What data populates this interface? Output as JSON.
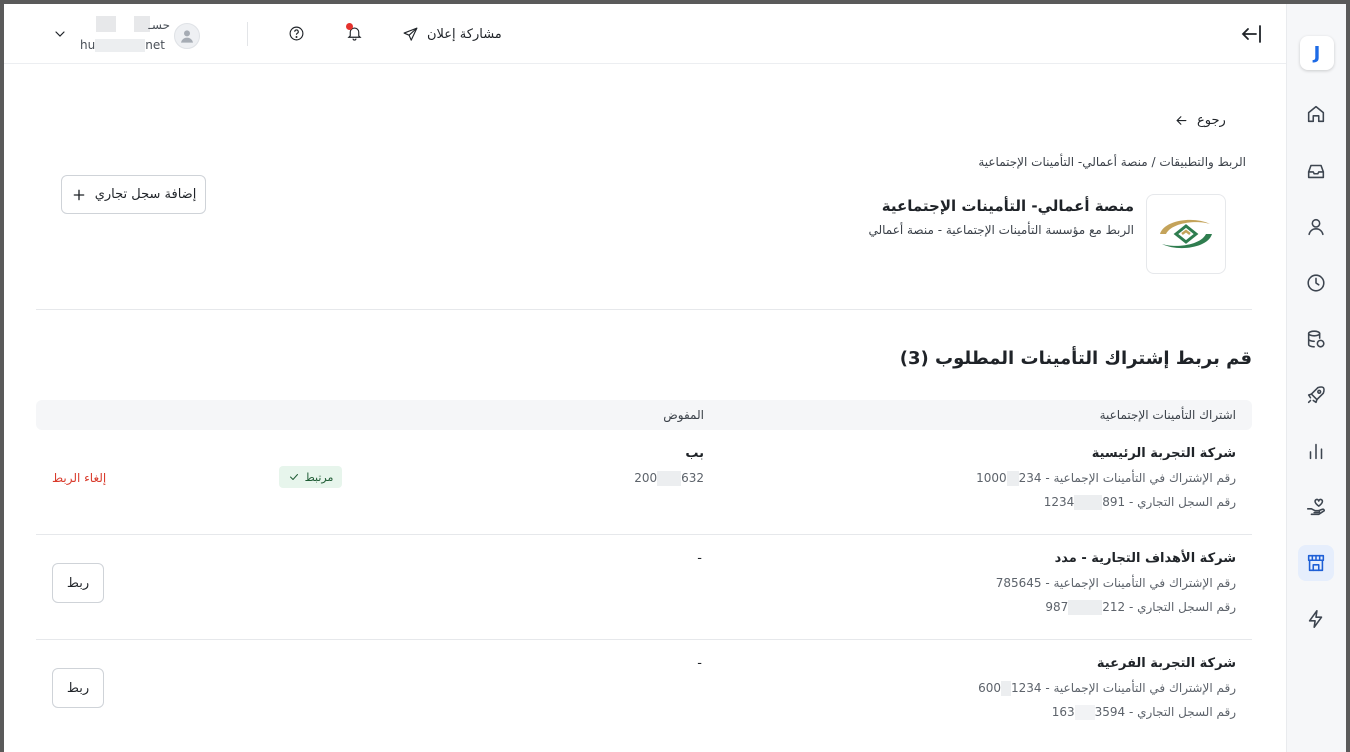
{
  "header": {
    "share_label": "مشاركة إعلان",
    "user_name": "حسـ",
    "user_email_start": "hu",
    "user_email_end": "net"
  },
  "sidebar": {
    "logo_letter": "J",
    "items": [
      "home-icon",
      "inbox-icon",
      "user-icon",
      "clock-icon",
      "database-icon",
      "rocket-icon",
      "chart-icon",
      "hand-heart-icon",
      "store-icon",
      "bolt-icon"
    ],
    "active": "store-icon"
  },
  "page": {
    "back_label": "رجوع",
    "breadcrumb": "الربط والتطبيقات / منصة أعمالي- التأمينات الإجتماعية",
    "app_title": "منصة أعمالي- التأمينات الإجتماعية",
    "app_subtitle": "الربط مع مؤسسة التأمينات الإجتماعية - منصة أعمالي",
    "add_button_label": "إضافة سجل تجاري",
    "section_title": "قم بربط إشتراك التأمينات المطلوب (3)"
  },
  "table": {
    "headers": {
      "subscription": "اشتراك التأمينات الإجتماعية",
      "authorized": "المفوض"
    },
    "rows": [
      {
        "name": "شركة التجربة الرئيسية",
        "insurance_label": "رقم الإشتراك في التأمينات الإجماعية - ",
        "insurance_number_a": "1000",
        "insurance_number_b": "234",
        "cr_label": "رقم السجل التجاري - ",
        "cr_number_a": "1234",
        "cr_number_b": "891",
        "authorized_name": "بب",
        "authorized_id_a": "200",
        "authorized_id_b": "632",
        "status": "مرتبط",
        "action": "إلغاء الربط"
      },
      {
        "name": "شركة الأهداف التجارية - مدد",
        "insurance_label": "رقم الإشتراك في التأمينات الإجماعية - ",
        "insurance_number": "785645",
        "cr_label": "رقم السجل التجاري - ",
        "cr_number_a": "987",
        "cr_number_b": "212",
        "authorized_placeholder": "-",
        "action": "ربط"
      },
      {
        "name": "شركة التجربة الفرعية",
        "insurance_label": "رقم الإشتراك في التأمينات الإجماعية - ",
        "insurance_number_a": "600",
        "insurance_number_b": "1234",
        "cr_label": "رقم السجل التجاري - ",
        "cr_number_a": "163",
        "cr_number_b": "3594",
        "authorized_placeholder": "-",
        "action": "ربط"
      }
    ]
  }
}
